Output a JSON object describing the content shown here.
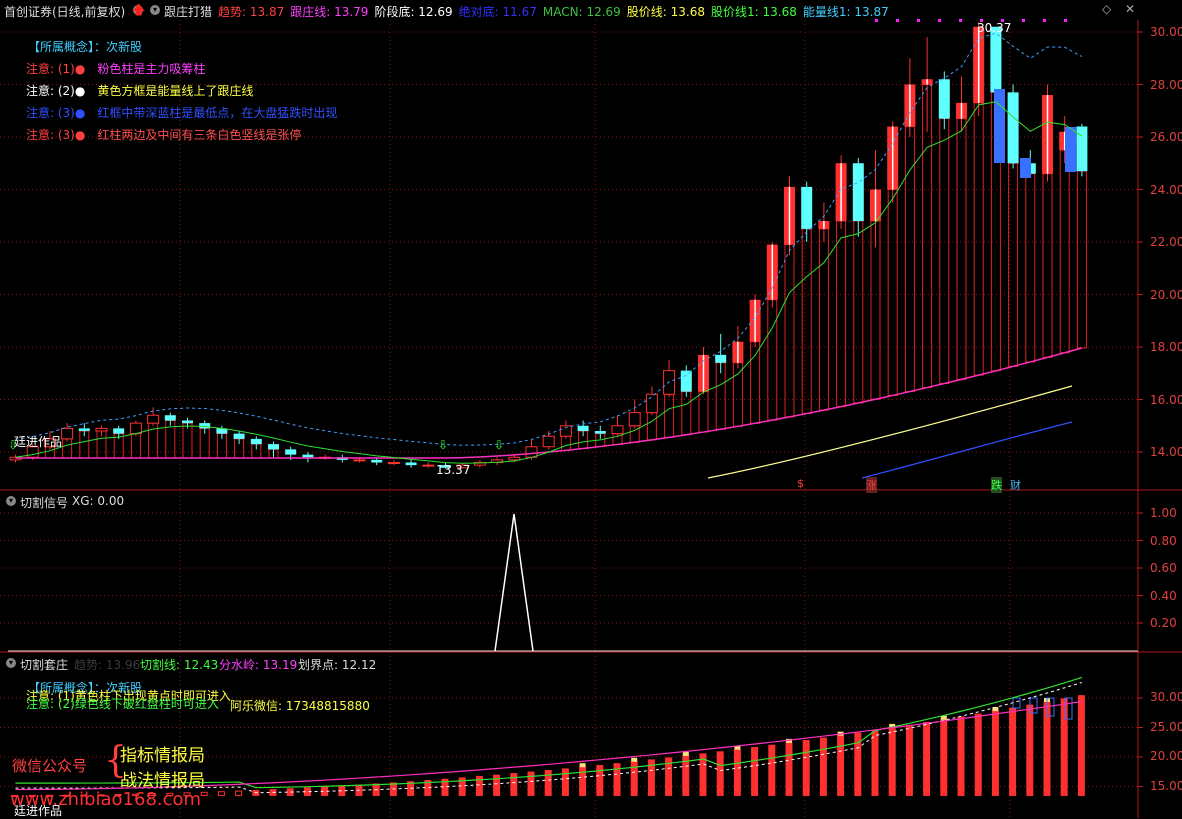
{
  "header": {
    "title": "首创证券(日线,前复权)",
    "indicator_name": "跟庄打猎",
    "items": [
      {
        "label": "趋势: 13.87",
        "color": "#ff4040"
      },
      {
        "label": "跟庄线: 13.79",
        "color": "#ff40ff"
      },
      {
        "label": "阶段底: 12.69",
        "color": "#ffffff"
      },
      {
        "label": "绝对底: 11.67",
        "color": "#3030ff"
      },
      {
        "label": "MACN: 12.69",
        "color": "#40c040"
      },
      {
        "label": "股价线: 13.68",
        "color": "#ffff40"
      },
      {
        "label": "股价线1: 13.68",
        "color": "#40ff40"
      },
      {
        "label": "能量线1: 13.87",
        "color": "#40d0ff"
      }
    ]
  },
  "main_notes": {
    "concept_label": "【所属概念】",
    "concept_value": "：次新股",
    "notes": [
      {
        "prefix": "注意: (1)●",
        "text": "粉色柱是主力吸筹柱",
        "color": "#ff40ff"
      },
      {
        "prefix": "注意: (2)●",
        "text": "黄色方框是能量线上了跟庄线",
        "color": "#ffff40"
      },
      {
        "prefix": "注意: (3)●",
        "text": "红框中带深蓝柱是最低点，在大盘猛跌时出现",
        "color": "#3050ff"
      },
      {
        "prefix": "注意: (3)●",
        "text": "红柱两边及中间有三条白色竖线是张停",
        "color": "#ff5050"
      }
    ],
    "left_label": "廷进作品",
    "high_label": "30.37",
    "low_label": "13.37",
    "bottom_marks": [
      {
        "label": "$",
        "color": "#ff4040"
      },
      {
        "label": "涨",
        "color": "#ff4040"
      },
      {
        "label": "跌",
        "color": "#40ff40"
      },
      {
        "label": "财",
        "color": "#40c0ff"
      }
    ]
  },
  "main_axis": [
    "30.00",
    "28.00",
    "26.00",
    "24.00",
    "22.00",
    "20.00",
    "18.00",
    "16.00",
    "14.00"
  ],
  "panel2": {
    "title": "切割信号",
    "value": "XG: 0.00",
    "axis": [
      "1.00",
      "0.80",
      "0.60",
      "0.40",
      "0.20"
    ]
  },
  "panel3": {
    "title": "切割套庄",
    "faint_item": "趋势: 13.96",
    "items": [
      {
        "label": "切割线: 12.43",
        "color": "#40ff40"
      },
      {
        "label": "分水岭: 13.19",
        "color": "#ff40ff"
      },
      {
        "label": "划界点: 12.12",
        "color": "#ffffff"
      }
    ],
    "concept": "【所属概念】：次新股",
    "note1": "注意: (1)黄色柱下出现黄点时即可进入",
    "note2": "注意: (2)绿色线下破红盘柱时可进入",
    "contact": "阿乐微信: 17348815880",
    "wechat_label": "微信公众号",
    "brace": "{",
    "brand1": "指标情报局",
    "brand2": "战法情报局",
    "watermark": "www.zhibiao168.com",
    "bottom_label": "廷进作品",
    "axis": [
      "30.00",
      "25.00",
      "20.00",
      "15.00"
    ]
  },
  "colors": {
    "up": "#ff3030",
    "down": "#60ffff",
    "grid": "#8a1010",
    "bg": "#000000"
  }
}
